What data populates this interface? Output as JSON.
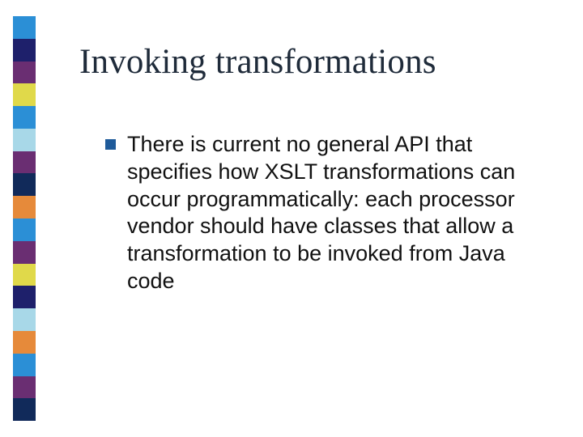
{
  "title": "Invoking transformations",
  "bullets": [
    "There is current no general API that specifies how XSLT transformations can occur programmatically: each processor vendor should have classes that allow a transformation to be invoked from Java code"
  ],
  "stripe_colors": [
    "#2b8fd6",
    "#1e206b",
    "#6a2e72",
    "#e0d94a",
    "#2b8fd6",
    "#a8d8e8",
    "#6a2e72",
    "#112a5a",
    "#e68a3a",
    "#2b8fd6",
    "#6a2e72",
    "#e0d94a",
    "#1e206b",
    "#a8d8e8",
    "#e68a3a",
    "#2b8fd6",
    "#6a2e72",
    "#112a5a"
  ]
}
